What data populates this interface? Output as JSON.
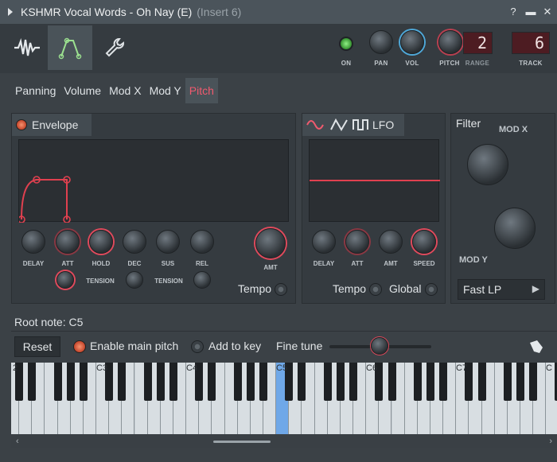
{
  "window": {
    "title": "KSHMR Vocal Words - Oh Nay (E)",
    "subtitle": "(Insert 6)"
  },
  "header": {
    "on_label": "ON",
    "pan_label": "PAN",
    "vol_label": "VOL",
    "pitch_label": "PITCH",
    "range_label": "RANGE",
    "range_value": "2",
    "track_label": "TRACK",
    "track_value": "6"
  },
  "tabs": [
    {
      "label": "Panning",
      "active": false
    },
    {
      "label": "Volume",
      "active": false
    },
    {
      "label": "Mod X",
      "active": false
    },
    {
      "label": "Mod Y",
      "active": false
    },
    {
      "label": "Pitch",
      "active": true
    }
  ],
  "envelope": {
    "title": "Envelope",
    "knobs": [
      "DELAY",
      "ATT",
      "HOLD",
      "DEC",
      "SUS",
      "REL"
    ],
    "amt_label": "AMT",
    "tension_label_1": "TENSION",
    "tension_label_2": "TENSION",
    "tempo_label": "Tempo"
  },
  "lfo": {
    "title": "LFO",
    "knobs": [
      "DELAY",
      "ATT",
      "AMT",
      "SPEED"
    ],
    "tempo_label": "Tempo",
    "global_label": "Global"
  },
  "filter": {
    "title": "Filter",
    "mod_x_label": "MOD X",
    "mod_y_label": "MOD Y",
    "type_value": "Fast LP"
  },
  "controls": {
    "root_note": "Root note: C5",
    "reset_label": "Reset",
    "enable_main_pitch": "Enable main pitch",
    "add_to_key": "Add to key",
    "fine_tune": "Fine tune"
  },
  "keyboard": {
    "octave_labels": [
      "2",
      "C3",
      "C4",
      "C5",
      "C6",
      "C7",
      "C"
    ],
    "highlighted_note": "C5"
  },
  "colors": {
    "accent": "#f05a6e",
    "envelope_curve": "#e0404f",
    "led_green": "#6fe36a",
    "highlight_key": "#6fa8e8"
  }
}
